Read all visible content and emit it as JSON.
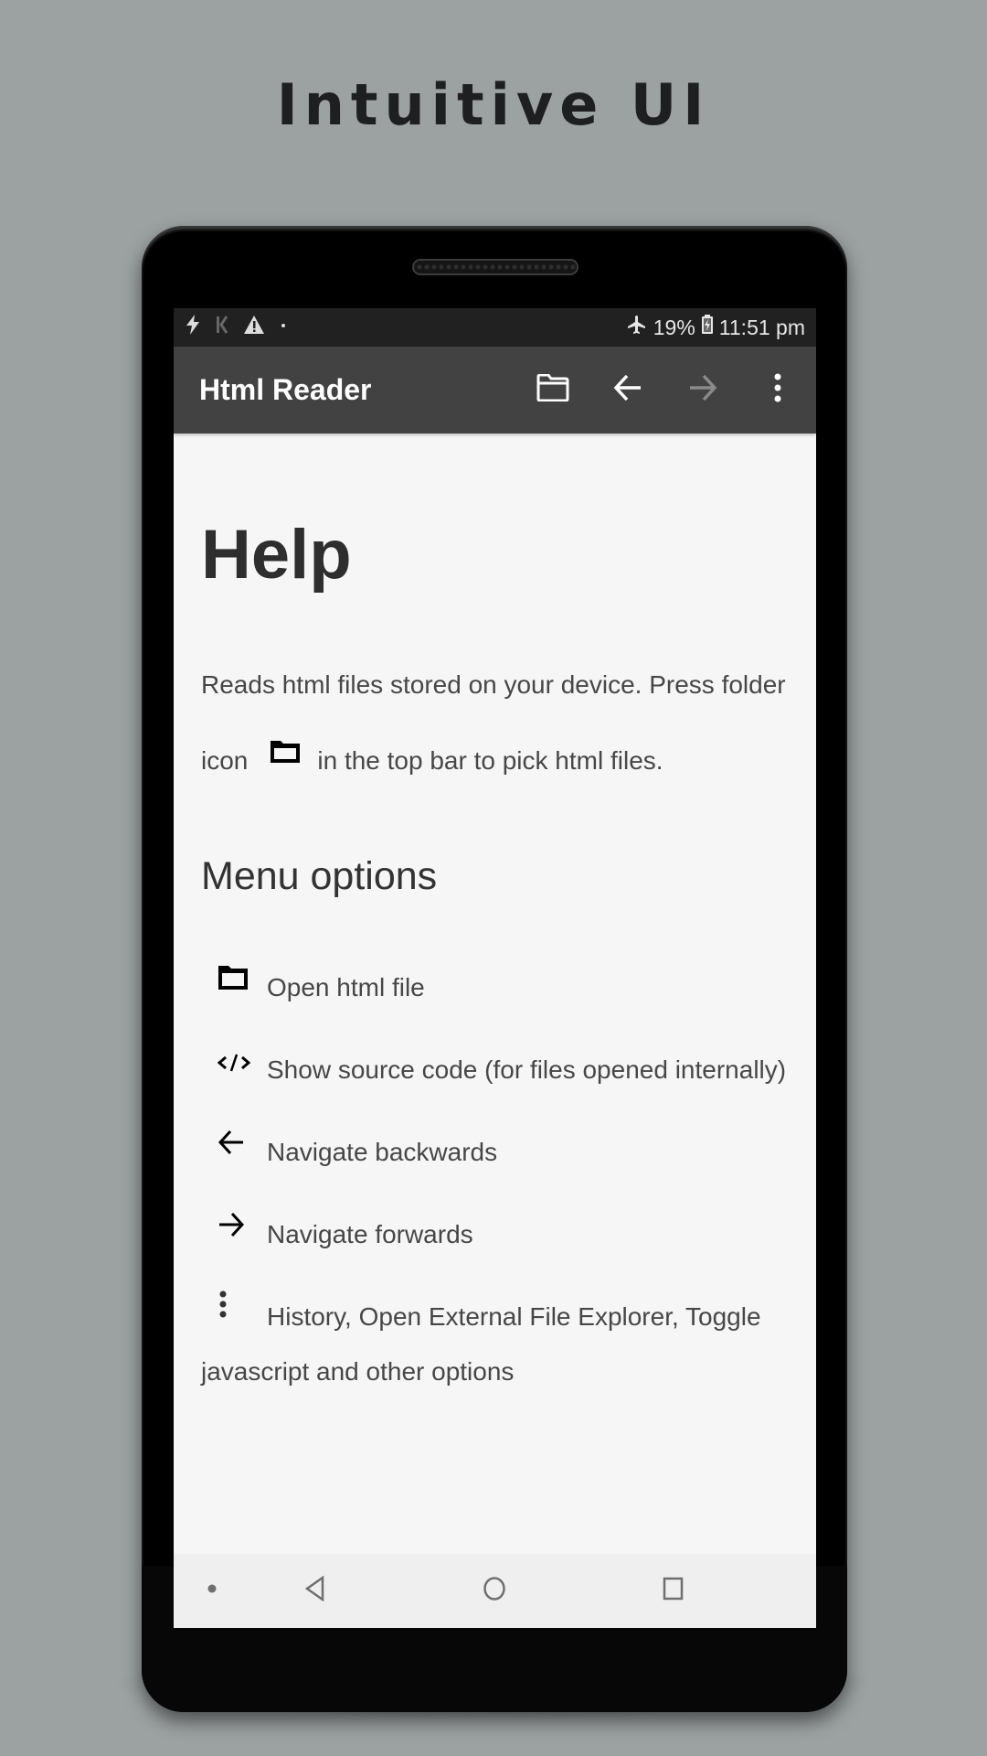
{
  "promo": {
    "title": "Intuitive UI"
  },
  "status_bar": {
    "left_icons": [
      "flash-icon",
      "k-app-icon",
      "warning-icon",
      "dot-icon"
    ],
    "airplane_mode": true,
    "battery": "19%",
    "time": "11:51 pm"
  },
  "toolbar": {
    "title": "Html Reader",
    "actions": [
      {
        "name": "open-folder",
        "icon": "folder-icon",
        "enabled": true
      },
      {
        "name": "back",
        "icon": "arrow-left-icon",
        "enabled": true
      },
      {
        "name": "forward",
        "icon": "arrow-right-icon",
        "enabled": false
      },
      {
        "name": "overflow-menu",
        "icon": "more-vert-icon",
        "enabled": true
      }
    ],
    "colors": {
      "bar": "#424242",
      "icon": "#ffffff",
      "disabled_icon": "#8a8a8a"
    }
  },
  "content": {
    "heading": "Help",
    "intro_before_icon": "Reads html files stored on your device. Press folder icon",
    "intro_after_icon": "in the top bar to pick html files.",
    "menu_heading": "Menu options",
    "menu_items": [
      {
        "icon": "folder-icon",
        "text": "Open html file"
      },
      {
        "icon": "code-icon",
        "text": "Show source code (for files opened internally)"
      },
      {
        "icon": "arrow-left-icon",
        "text": "Navigate backwards"
      },
      {
        "icon": "arrow-right-icon",
        "text": "Navigate forwards"
      },
      {
        "icon": "more-vert-icon",
        "text": "History, Open External File Explorer, Toggle javascript and other options"
      }
    ]
  },
  "nav_bar": {
    "buttons": [
      "dot",
      "back",
      "home",
      "recents"
    ]
  }
}
